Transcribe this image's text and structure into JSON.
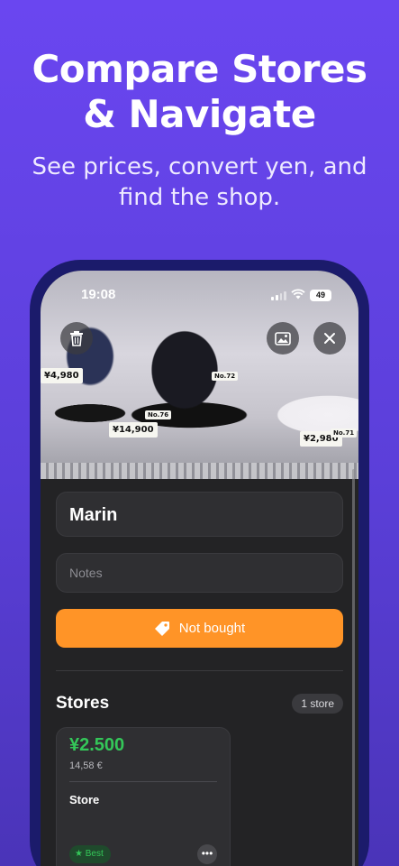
{
  "hero": {
    "title_line1": "Compare Stores",
    "title_line2": "& Navigate",
    "subtitle": "See prices, convert yen, and find the shop."
  },
  "status_bar": {
    "time": "19:08",
    "battery": "49"
  },
  "photo_tags": [
    {
      "text": "¥4,980"
    },
    {
      "text": "¥14,900"
    },
    {
      "text": "¥2,980"
    },
    {
      "text": "No.76"
    },
    {
      "text": "No.72"
    },
    {
      "text": "No.71"
    }
  ],
  "item": {
    "name": "Marin",
    "notes_placeholder": "Notes",
    "status_label": "Not bought"
  },
  "stores": {
    "title": "Stores",
    "count_label": "1 store",
    "cards": [
      {
        "price": "¥2.500",
        "converted": "14,58 €",
        "store_name": "Store",
        "badge": "Best"
      }
    ]
  },
  "icons": {
    "delete": "trash-icon",
    "image": "image-icon",
    "close": "close-icon",
    "tag": "tag-icon",
    "star": "star-icon",
    "more": "ellipsis-icon"
  },
  "colors": {
    "background": "#6a46f0",
    "status_button": "#ff9427",
    "price_green": "#34c759"
  }
}
